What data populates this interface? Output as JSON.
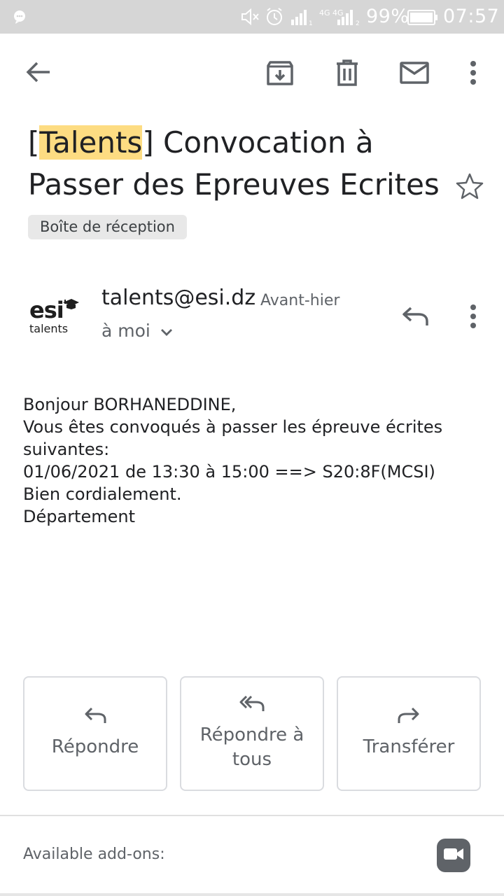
{
  "status_bar": {
    "network_labels": "4G 4G",
    "battery": "99%",
    "time": "07:57"
  },
  "toolbar": {
    "back_icon": "arrow-left-icon",
    "archive_icon": "archive-icon",
    "delete_icon": "trash-icon",
    "mark_unread_icon": "envelope-icon",
    "more_icon": "more-vert-icon"
  },
  "email": {
    "subject_bracket_open": "[",
    "subject_highlight": "Talents",
    "subject_rest_line1": "] Convocation à",
    "subject_line2": "Passer des Epreuves Ecrites",
    "label": "Boîte de réception",
    "sender_logo_text": "esi",
    "sender_logo_subtext": "talents",
    "sender": "talents@esi.dz",
    "date": "Avant-hier",
    "recipient": "à moi",
    "body_lines": [
      "Bonjour BORHANEDDINE,",
      "Vous êtes convoqués à passer les épreuve écrites",
      "suivantes:",
      "01/06/2021 de 13:30 à 15:00 ==> S20:8F(MCSI)",
      "Bien cordialement.",
      "Département"
    ]
  },
  "actions": {
    "reply": "Répondre",
    "reply_all": "Répondre à tous",
    "forward": "Transférer"
  },
  "addons": {
    "label": "Available add-ons:",
    "meet_icon": "video-camera-icon"
  },
  "colors": {
    "highlight": "#fddc82",
    "chip_bg": "#e8e8e8",
    "icon_gray": "#5f6368",
    "status_bar_bg": "#d6d6d6"
  }
}
